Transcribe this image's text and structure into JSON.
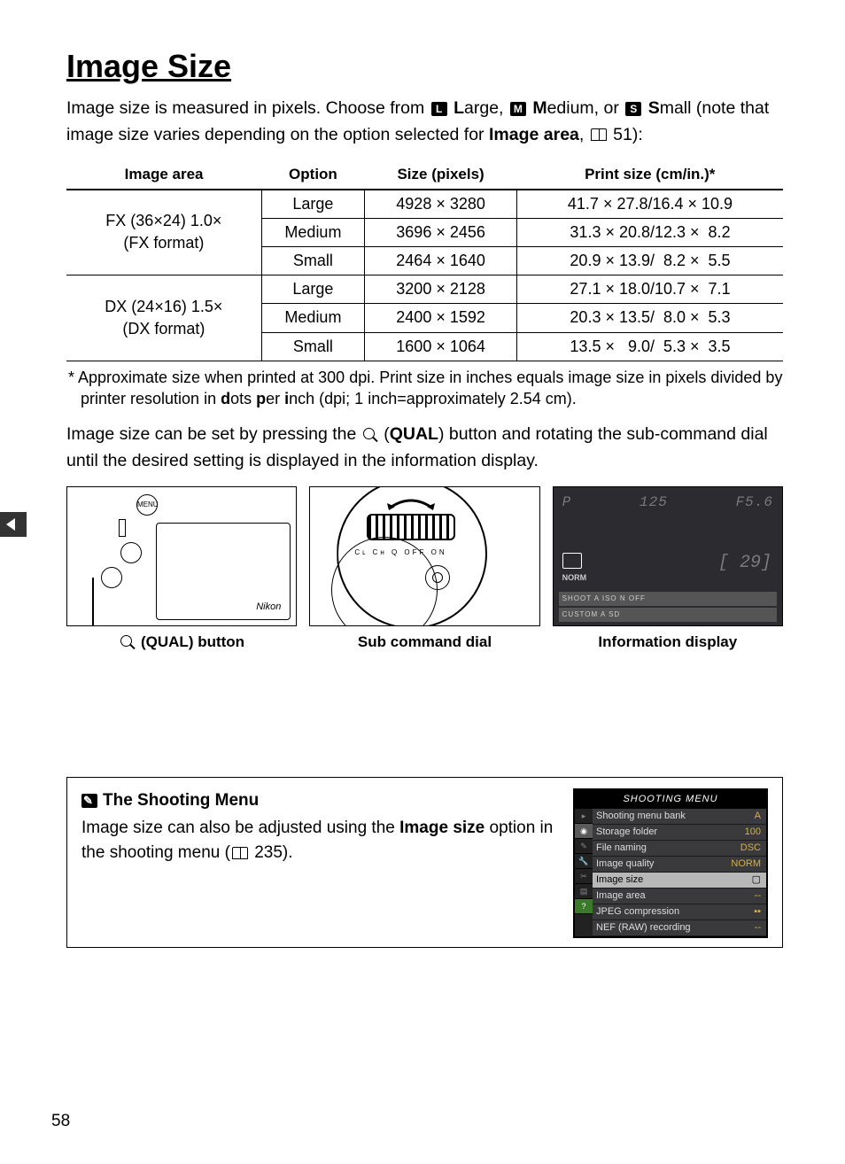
{
  "heading": "Image Size",
  "intro_p1a": "Image size is measured in pixels.  Choose from ",
  "intro_large": "Large, ",
  "intro_medium": "Medium, or ",
  "intro_small": "Small (note that image size varies depending on the option selected for ",
  "intro_bold": "Image area",
  "intro_tail": ", ",
  "intro_pageref": " 51):",
  "icon_L": "L",
  "icon_M": "M",
  "icon_S": "S",
  "table": {
    "headers": [
      "Image area",
      "Option",
      "Size (pixels)",
      "Print size (cm/in.)*"
    ],
    "fx_area": "FX (36×24) 1.0×\n(FX format)",
    "dx_area": "DX (24×16) 1.5×\n(DX format)",
    "rows": [
      {
        "opt": "Large",
        "px": "4928 × 3280",
        "print": "41.7 × 27.8/16.4 × 10.9"
      },
      {
        "opt": "Medium",
        "px": "3696 × 2456",
        "print": "31.3 × 20.8/12.3 ×  8.2"
      },
      {
        "opt": "Small",
        "px": "2464 × 1640",
        "print": "20.9 × 13.9/  8.2 ×  5.5"
      },
      {
        "opt": "Large",
        "px": "3200 × 2128",
        "print": "27.1 × 18.0/10.7 ×  7.1"
      },
      {
        "opt": "Medium",
        "px": "2400 × 1592",
        "print": "20.3 × 13.5/  8.0 ×  5.3"
      },
      {
        "opt": "Small",
        "px": "1600 × 1064",
        "print": "13.5 ×   9.0/  5.3 ×  3.5"
      }
    ]
  },
  "footnote": "* Approximate size when printed at 300 dpi.  Print size in inches equals image size in pixels divided by printer resolution in dots per inch (dpi; 1 inch=approximately 2.54 cm).",
  "para2a": "Image size can be set by pressing the ",
  "para2_qual": "QUAL",
  "para2b": ") button and rotating the sub-command dial until the desired setting is displayed in the information display.",
  "cap1_qual": "QUAL",
  "cap1_tail": ") button",
  "cap2": "Sub command dial",
  "cap3": "Information display",
  "info_p": "P",
  "info_shutter": "125",
  "info_f": "F5.6",
  "info_count": "[  29]",
  "info_norm": "NORM",
  "info_s1": "SHOOT A  ISO  N        OFF",
  "info_s2": "CUSTOM A         SD",
  "cam1_menu": "MENU",
  "box_heading": "The Shooting Menu",
  "box_p1": "Image size can also be adjusted using the ",
  "box_bold": "Image size",
  "box_p2": " option in the shooting menu (",
  "box_page": " 235).",
  "menu": {
    "title": "SHOOTING MENU",
    "rows": [
      {
        "label": "Shooting menu bank",
        "val": "A"
      },
      {
        "label": "Storage folder",
        "val": "100"
      },
      {
        "label": "File naming",
        "val": "DSC"
      },
      {
        "label": "Image quality",
        "val": "NORM"
      },
      {
        "label": "Image size",
        "val": "▢",
        "hl": true
      },
      {
        "label": "Image area",
        "val": "--"
      },
      {
        "label": "JPEG compression",
        "val": "▪▪"
      },
      {
        "label": "NEF (RAW) recording",
        "val": "--"
      }
    ]
  },
  "page_number": "58"
}
